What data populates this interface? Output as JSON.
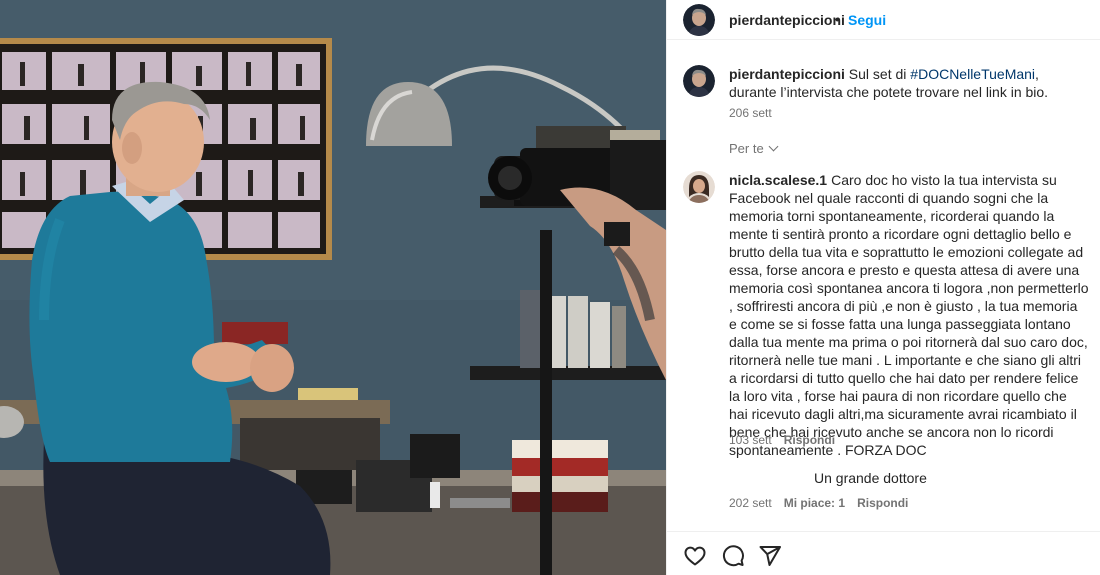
{
  "post": {
    "author": "pierdantepiccioni",
    "dot": "•",
    "follow_label": "Segui"
  },
  "caption": {
    "username": "pierdantepiccioni",
    "text_before": " Sul set di ",
    "hashtag": "#DOCNelleTueMani",
    "text_after": ", durante l’intervista che potete trovare nel link in bio.",
    "time": "206 sett"
  },
  "for_you": {
    "label": "Per te"
  },
  "comments": [
    {
      "username": "nicla.scalese.1",
      "text": "Caro doc ho visto la tua intervista su Facebook nel quale racconti di quando sogni che la memoria torni spontaneamente, ricorderai quando la mente ti sentirà pronto a ricordare ogni dettaglio bello e brutto della tua vita e soprattutto le emozioni collegate ad essa, forse ancora e presto e questa attesa di avere una memoria così spontanea ancora ti logora ,non permetterlo , soffriresti ancora di più ,e non è giusto , la tua memoria e come se si fosse fatta una lunga passeggiata lontano dalla tua mente ma prima o poi ritornerà dal suo caro doc, ritornerà nelle tue mani . L importante e che siano gli altri a ricordarsi di tutto quello che hai dato per rendere felice la loro vita , forse hai paura di non ricordare quello che hai ricevuto dagli altri,ma sicuramente avrai ricambiato il bene che hai ricevuto anche se ancora non lo ricordi spontaneamente . FORZA DOC",
      "time": "103 sett",
      "reply_label": "Rispondi"
    }
  ],
  "reply": {
    "text": "Un grande dottore",
    "time": "202 sett",
    "likes": "Mi piace: 1",
    "reply_label": "Rispondi"
  },
  "icons": {
    "like": "heart-icon",
    "comment": "comment-icon",
    "share": "paper-plane-icon"
  },
  "colors": {
    "follow_blue": "#0095f6",
    "hashtag": "#00376b",
    "secondary_text": "#737373",
    "divider": "#efefef"
  }
}
